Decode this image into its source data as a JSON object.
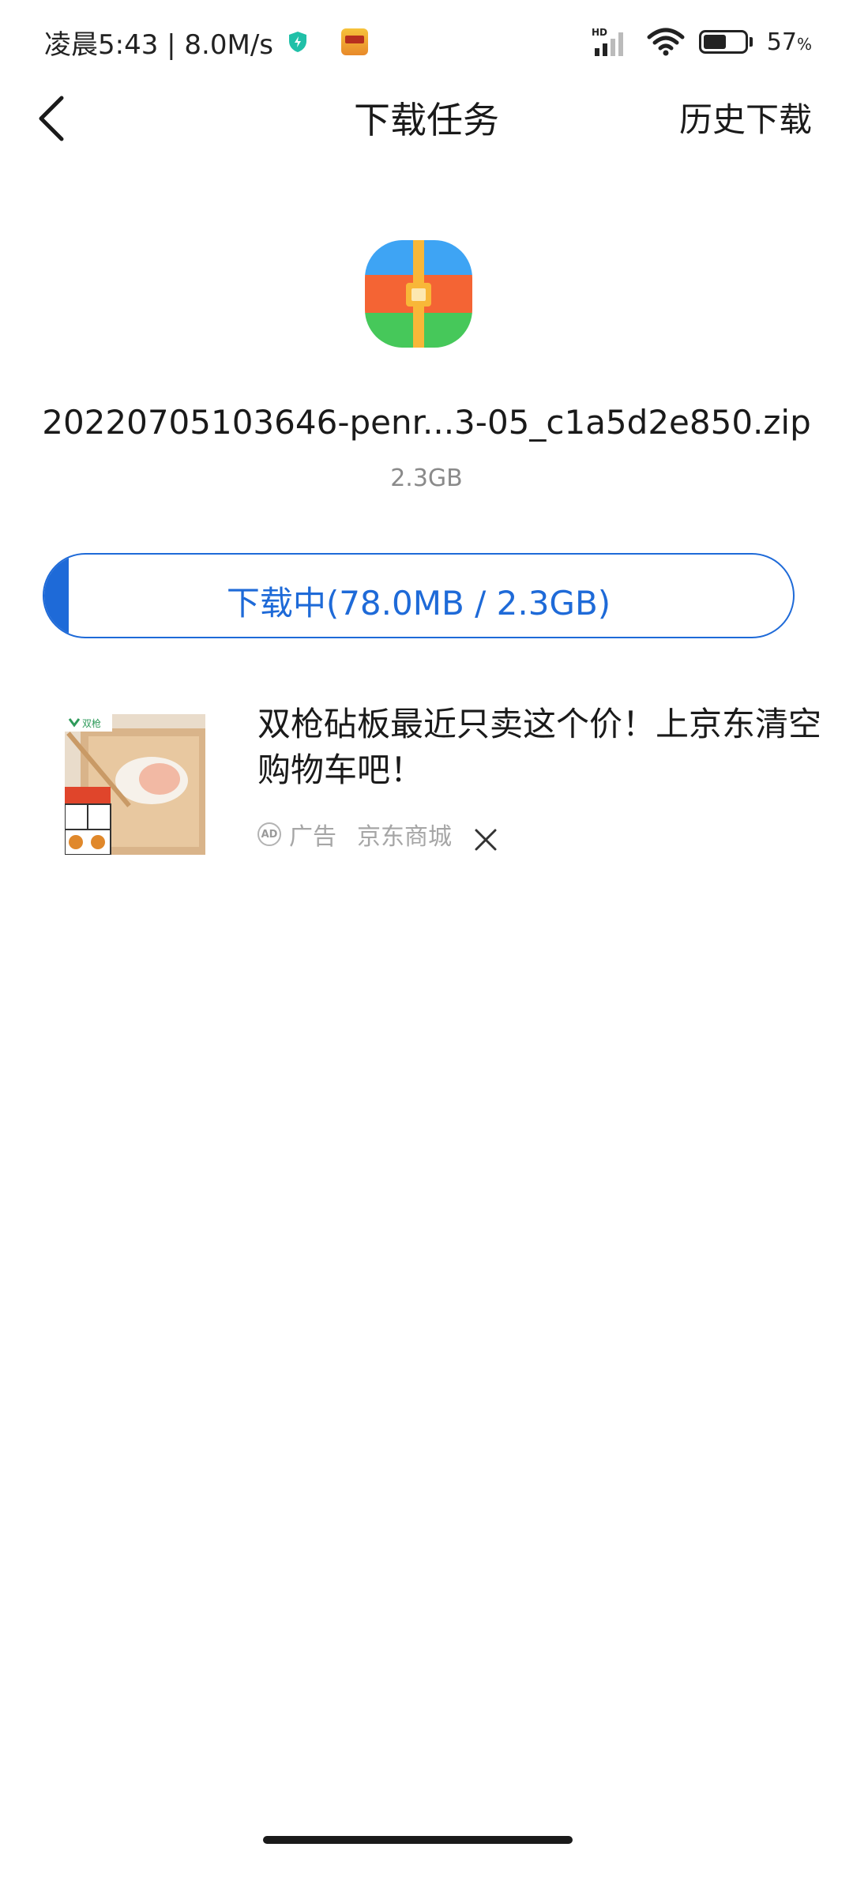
{
  "status_bar": {
    "left_text": "凌晨5:43 | 8.0M/s",
    "network_label": "HD",
    "battery_percent": "57",
    "battery_unit": "%",
    "battery_level": 0.57
  },
  "header": {
    "title": "下载任务",
    "history_label": "历史下载"
  },
  "file": {
    "name": "20220705103646-penr...3-05_c1a5d2e850.zip",
    "size": "2.3GB",
    "icon": "zip-archive-icon"
  },
  "download": {
    "status_label": "下载中(78.0MB / 2.3GB)",
    "progress": 0.033,
    "color": "#1e6ad8"
  },
  "ad": {
    "title": "双枪砧板最近只卖这个价！上京东清空购物车吧！",
    "badge": "AD",
    "label": "广告",
    "source": "京东商城",
    "image_brand": "双枪"
  }
}
